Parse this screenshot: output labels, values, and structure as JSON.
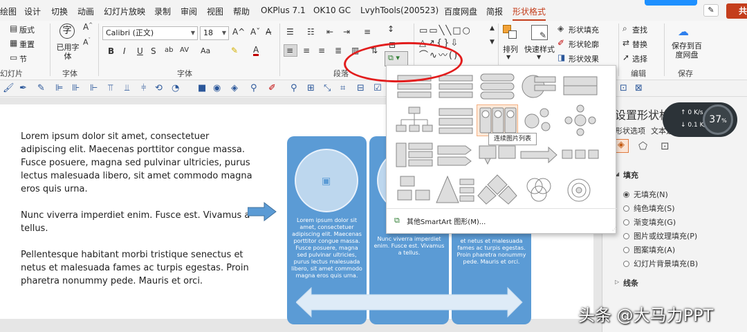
{
  "menu": {
    "tabs": [
      "绘图",
      "设计",
      "切换",
      "动画",
      "幻灯片放映",
      "录制",
      "审阅",
      "视图",
      "帮助",
      "OKPlus 7.1",
      "OK10 GC",
      "LvyhTools(200523)",
      "百度网盘",
      "简报",
      "形状格式"
    ],
    "active_tab": "形状格式",
    "share_label": "共"
  },
  "ribbon": {
    "slides": {
      "layout": "版式",
      "reset": "重置",
      "section": "节",
      "group": "幻灯片"
    },
    "font": {
      "font_name": "Calibri (正文)",
      "font_size": "18",
      "change_case": "已用字体",
      "group": "字体",
      "bold": "B",
      "italic": "I",
      "underline": "U",
      "strike": "S",
      "spacing": "AV",
      "grow": "A",
      "shrink": "A"
    },
    "paragraph": {
      "group": "段落"
    },
    "drawing": {
      "arrange": "排列",
      "quick_styles": "快速样式",
      "shape_fill": "形状填充",
      "shape_outline": "形状轮廓",
      "shape_effects": "形状效果"
    },
    "editing": {
      "find": "查找",
      "replace": "替换",
      "select": "选择",
      "group": "编辑"
    },
    "save": {
      "baidu": "保存到百度网盘",
      "group": "保存"
    }
  },
  "slide": {
    "paragraphs": [
      "Lorem ipsum dolor sit amet, consectetuer adipiscing elit. Maecenas porttitor congue massa. Fusce posuere, magna sed pulvinar ultricies, purus lectus malesuada libero, sit amet commodo magna eros quis urna.",
      "Nunc viverra imperdiet enim. Fusce est. Vivamus a tellus.",
      "Pellentesque habitant morbi tristique senectus et netus et malesuada fames ac turpis egestas. Proin pharetra nonummy pede. Mauris et orci."
    ],
    "card1_text": "Lorem ipsum dolor sit amet, consectetuer adipiscing elit. Maecenas porttitor congue massa. Fusce posuere, magna sed pulvinar ultricies, purus lectus malesuada libero, sit amet commodo magna eros quis urna.",
    "card2_text": "Nunc viverra imperdiet enim. Fusce est. Vivamus a tellus.",
    "card3_text": "et netus et malesuada fames ac turpis egestas. Proin pharetra nonummy pede. Mauris et orci."
  },
  "gallery": {
    "tooltip": "连续图片列表",
    "more_label": "其他SmartArt 图形(M)..."
  },
  "pane": {
    "title": "设置形状格式",
    "tab_shape": "形状选项",
    "tab_text": "文本选项",
    "fill_section": "填充",
    "fill_options": [
      "无填充(N)",
      "纯色填充(S)",
      "渐变填充(G)",
      "图片或纹理填充(P)",
      "图案填充(A)",
      "幻灯片背景填充(B)"
    ],
    "selected_fill": 0,
    "line_section": "线条"
  },
  "speed": {
    "upload": "0 K/s",
    "download": "0.1 K/s",
    "cpu": "37",
    "cpu_unit": "%"
  },
  "watermark": "头条 @大马力PPT",
  "colors": {
    "accent": "#c43e1c",
    "card": "#5b9bd5",
    "card_circle": "#bdd7ee",
    "highlight_ring": "#e21d1d"
  }
}
